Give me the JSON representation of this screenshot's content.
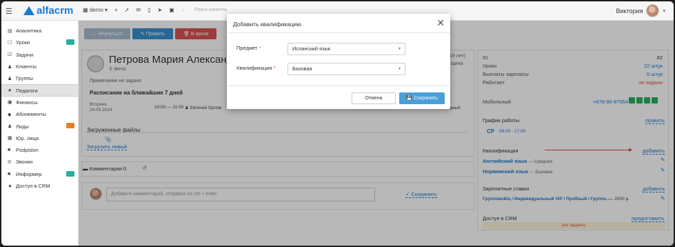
{
  "app": {
    "logo_text": "alfacrm"
  },
  "toolbar": {
    "branch": "demo",
    "search_placeholder": "Поиск клиента"
  },
  "user": {
    "name": "Виктория"
  },
  "sidebar": {
    "items": [
      {
        "label": "Аналитика",
        "icon": "chart-icon"
      },
      {
        "label": "Уроки",
        "icon": "calendar-icon",
        "badge": "",
        "badge_color": "#27ae9c"
      },
      {
        "label": "Задачи",
        "icon": "tasks-icon"
      },
      {
        "label": "Клиенты",
        "icon": "user-icon"
      },
      {
        "label": "Группы",
        "icon": "group-icon"
      },
      {
        "label": "Педагоги",
        "icon": "teacher-icon",
        "active": true
      },
      {
        "label": "Финансы",
        "icon": "money-icon"
      },
      {
        "label": "Абонементы",
        "icon": "tag-icon"
      },
      {
        "label": "Лиды",
        "icon": "leads-icon",
        "badge": "",
        "badge_color": "#e67e22"
      },
      {
        "label": "Юр. лица",
        "icon": "building-icon"
      },
      {
        "label": "Podpislon",
        "icon": "doc-icon"
      },
      {
        "label": "Звонки",
        "icon": "phone-icon"
      },
      {
        "label": "Информер",
        "icon": "informer-icon",
        "badge": "",
        "badge_color": "#27ae9c"
      },
      {
        "label": "Доступ в CRM",
        "icon": "access-icon"
      }
    ]
  },
  "actions": [
    {
      "label": "Вернуться",
      "color": "#a7bccd"
    },
    {
      "label": "Править",
      "color": "#3a8fd0"
    },
    {
      "label": "В архив",
      "color": "#d9534f"
    }
  ],
  "teacher": {
    "name": "Петрова Мария Александровна",
    "branch": "demo",
    "note": "Примечание не задано",
    "schedule_title": "Расписание на ближайшие 7 дней",
    "schedule_day": "Вторник,",
    "schedule_date": "24.09.2024",
    "schedule_time": "10:00 — 11:00",
    "schedule_teacher": "Евгений Орлов",
    "age": "19 лет)",
    "gender": "щина",
    "lesson_type": "дный"
  },
  "files": {
    "title": "Загруженные файлы",
    "upload_link": "Загрузить новый"
  },
  "comments": {
    "tab_label": "Комментарии 0",
    "placeholder": "Добавьте комментарий, отправка по ctrl + enter",
    "save_label": "Сохранить"
  },
  "right_panel": {
    "rows": [
      {
        "label": "ID",
        "value": "#2",
        "value_color": "#333"
      },
      {
        "label": "Уроки",
        "value": "22 штук",
        "value_color": "#1b78cf"
      },
      {
        "label": "Выплаты зарплаты",
        "value": "0 штук",
        "value_color": "#1b78cf"
      },
      {
        "label": "Работает",
        "value": "не задано",
        "value_color": "#e74c3c"
      }
    ],
    "mobile_label": "Мобильный",
    "mobile_value": "+678-90-87654",
    "work_schedule_title": "График работы",
    "work_schedule_link": "править",
    "work_day": "СР",
    "work_hours": "08:00 - 17:00",
    "qual_title": "Квалификация",
    "qual_add": "добавить",
    "qualifications": [
      {
        "subject": "Английский язык",
        "level": "— Средняя"
      },
      {
        "subject": "Норвежский язык",
        "level": "— Базовая"
      }
    ],
    "salary_title": "Зарплатные ставки",
    "salary_add": "добавить",
    "salary_item": "Групповой/ц / Индивидуальный VIP / Пробный / Группо...",
    "salary_value": "— 2000 р.",
    "crm_title": "Доступ в CRM",
    "crm_link": "предоставить",
    "crm_value": "(не задано)"
  },
  "modal": {
    "title": "Добавить квалификацию",
    "subject_label": "Предмет",
    "subject_value": "Испанский язык",
    "qual_label": "Квалификация",
    "qual_value": "Базовая",
    "cancel_label": "Отмена",
    "save_label": "Сохранить"
  }
}
